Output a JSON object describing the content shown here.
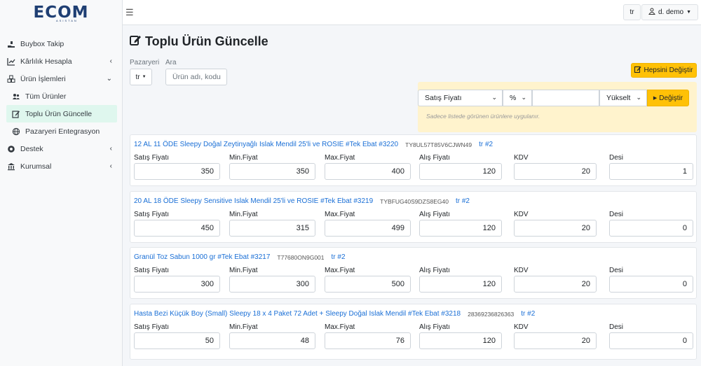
{
  "brand": {
    "logo": "ECOM",
    "subtitle": "ASISTAN"
  },
  "sidebar": {
    "items": [
      {
        "label": "Buybox Takip"
      },
      {
        "label": "Kârlılık Hesapla"
      },
      {
        "label": "Ürün İşlemleri"
      },
      {
        "label": "Tüm Ürünler"
      },
      {
        "label": "Toplu Ürün Güncelle"
      },
      {
        "label": "Pazaryeri Entegrasyon"
      },
      {
        "label": "Destek"
      },
      {
        "label": "Kurumsal"
      }
    ]
  },
  "topbar": {
    "lang": "tr",
    "user": "d. demo"
  },
  "page": {
    "title": "Toplu Ürün Güncelle"
  },
  "filters": {
    "marketplace_label": "Pazaryeri",
    "marketplace_value": "tr",
    "search_label": "Ara",
    "search_placeholder": "Ürün adı, kodu"
  },
  "bulk": {
    "change_all_label": "Hepsini Değiştir",
    "field": "Satış Fiyatı",
    "unit": "%",
    "amount": "",
    "direction": "Yükselt",
    "apply_label": "Değiştir",
    "note": "Sadece listede görünen ürünlere uygulanır."
  },
  "field_labels": [
    "Satış Fiyatı",
    "Min.Fiyat",
    "Max.Fiyat",
    "Alış Fiyatı",
    "KDV",
    "Desi"
  ],
  "products": [
    {
      "name": "12 AL 11 ÖDE Sleepy Doğal Zeytinyağlı Islak Mendil 25'li ve ROSIE #Tek Ebat #3220",
      "sku": "TY8UL57T85V6CJWN49",
      "marketplace": "tr #2",
      "values": [
        "350",
        "350",
        "400",
        "120",
        "20",
        "1"
      ]
    },
    {
      "name": "20 AL 18 ÖDE Sleepy Sensitive Islak Mendil 25'li ve ROSIE #Tek Ebat #3219",
      "sku": "TYBFUG40S9DZS8EG40",
      "marketplace": "tr #2",
      "values": [
        "450",
        "315",
        "499",
        "120",
        "20",
        "0"
      ]
    },
    {
      "name": "Granül Toz Sabun 1000 gr #Tek Ebat #3217",
      "sku": "T77680ON9G001",
      "marketplace": "tr #2",
      "values": [
        "300",
        "300",
        "500",
        "120",
        "20",
        "0"
      ]
    },
    {
      "name": "Hasta Bezi Küçük Boy (Small) Sleepy 18 x 4 Paket 72 Adet + Sleepy Doğal Islak Mendil #Tek Ebat #3218",
      "sku": "28369236826363",
      "marketplace": "tr #2",
      "values": [
        "50",
        "48",
        "76",
        "120",
        "20",
        "0"
      ]
    }
  ]
}
